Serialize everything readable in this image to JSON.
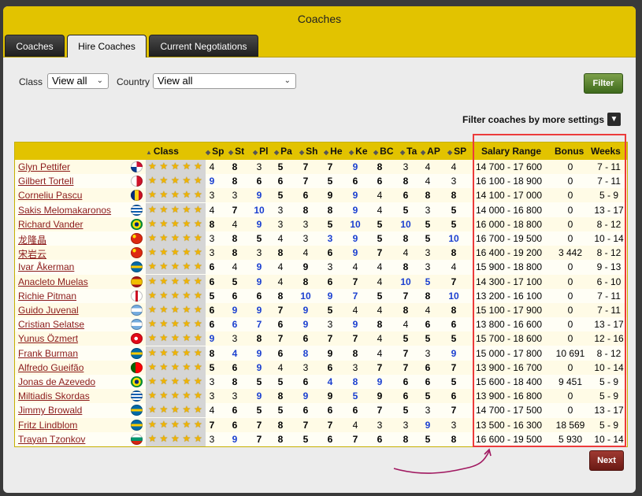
{
  "window": {
    "title": "Coaches"
  },
  "tabs": [
    {
      "label": "Coaches",
      "active": false
    },
    {
      "label": "Hire Coaches",
      "active": true
    },
    {
      "label": "Current Negotiations",
      "active": false
    }
  ],
  "filters": {
    "class_label": "Class",
    "class_value": "View all",
    "country_label": "Country",
    "country_value": "View all",
    "filter_button": "Filter",
    "more_settings": "Filter coaches by more settings"
  },
  "table": {
    "headers": {
      "class": "Class",
      "sp": "Sp",
      "st": "St",
      "pl": "Pl",
      "pa": "Pa",
      "sh": "Sh",
      "he": "He",
      "ke": "Ke",
      "bc": "BC",
      "ta": "Ta",
      "ap": "AP",
      "spt": "SP",
      "salary": "Salary Range",
      "bonus": "Bonus",
      "weeks": "Weeks"
    },
    "rows": [
      {
        "name": "Glyn Pettifer",
        "flag": "panama",
        "stars": 5,
        "sp": "4",
        "st": "8",
        "pl": "3",
        "pa": "5",
        "sh": "7",
        "he": "7",
        "ke": "9",
        "bc": "8",
        "ta": "3",
        "ap": "4",
        "spt": "4",
        "salary": "14 700 - 17 600",
        "bonus": "0",
        "weeks": "7 - 11"
      },
      {
        "name": "Gilbert Tortell",
        "flag": "malta",
        "stars": 5,
        "sp": "9",
        "st": "8",
        "pl": "6",
        "pa": "6",
        "sh": "7",
        "he": "5",
        "ke": "6",
        "bc": "6",
        "ta": "8",
        "ap": "4",
        "spt": "3",
        "salary": "16 100 - 18 900",
        "bonus": "0",
        "weeks": "7 - 11"
      },
      {
        "name": "Corneliu Pascu",
        "flag": "romania",
        "stars": 5,
        "sp": "3",
        "st": "3",
        "pl": "9",
        "pa": "5",
        "sh": "6",
        "he": "9",
        "ke": "9",
        "bc": "4",
        "ta": "6",
        "ap": "8",
        "spt": "8",
        "salary": "14 100 - 17 000",
        "bonus": "0",
        "weeks": "5 - 9"
      },
      {
        "name": "Sakis Melomakaronos",
        "flag": "greece",
        "stars": 5,
        "sp": "4",
        "st": "7",
        "pl": "10",
        "pa": "3",
        "sh": "8",
        "he": "8",
        "ke": "9",
        "bc": "4",
        "ta": "5",
        "ap": "3",
        "spt": "5",
        "salary": "14 000 - 16 800",
        "bonus": "0",
        "weeks": "13 - 17"
      },
      {
        "name": "Richard Vander",
        "flag": "brazil",
        "stars": 5,
        "sp": "8",
        "st": "4",
        "pl": "9",
        "pa": "3",
        "sh": "3",
        "he": "5",
        "ke": "10",
        "bc": "5",
        "ta": "10",
        "ap": "5",
        "spt": "5",
        "salary": "16 000 - 18 800",
        "bonus": "0",
        "weeks": "8 - 12"
      },
      {
        "name": "龙隆晶",
        "flag": "china",
        "stars": 5,
        "sp": "3",
        "st": "8",
        "pl": "5",
        "pa": "4",
        "sh": "3",
        "he": "3",
        "ke": "9",
        "bc": "5",
        "ta": "8",
        "ap": "5",
        "spt": "10",
        "salary": "16 700 - 19 500",
        "bonus": "0",
        "weeks": "10 - 14"
      },
      {
        "name": "宋岩云",
        "flag": "china",
        "stars": 5,
        "sp": "3",
        "st": "8",
        "pl": "3",
        "pa": "8",
        "sh": "4",
        "he": "6",
        "ke": "9",
        "bc": "7",
        "ta": "4",
        "ap": "3",
        "spt": "8",
        "salary": "16 400 - 19 200",
        "bonus": "3 442",
        "weeks": "8 - 12"
      },
      {
        "name": "Ivar Åkerman",
        "flag": "sweden",
        "stars": 5,
        "sp": "6",
        "st": "4",
        "pl": "9",
        "pa": "4",
        "sh": "9",
        "he": "3",
        "ke": "4",
        "bc": "4",
        "ta": "8",
        "ap": "3",
        "spt": "4",
        "salary": "15 900 - 18 800",
        "bonus": "0",
        "weeks": "9 - 13"
      },
      {
        "name": "Anacleto Muelas",
        "flag": "spain",
        "stars": 5,
        "sp": "6",
        "st": "5",
        "pl": "9",
        "pa": "4",
        "sh": "8",
        "he": "6",
        "ke": "7",
        "bc": "4",
        "ta": "10",
        "ap": "5",
        "spt": "7",
        "salary": "14 300 - 17 100",
        "bonus": "0",
        "weeks": "6 - 10"
      },
      {
        "name": "Richie Pitman",
        "flag": "england",
        "stars": 5,
        "sp": "5",
        "st": "6",
        "pl": "6",
        "pa": "8",
        "sh": "10",
        "he": "9",
        "ke": "7",
        "bc": "5",
        "ta": "7",
        "ap": "8",
        "spt": "10",
        "salary": "13 200 - 16 100",
        "bonus": "0",
        "weeks": "7 - 11"
      },
      {
        "name": "Guido Juvenal",
        "flag": "argentina",
        "stars": 5,
        "sp": "6",
        "st": "9",
        "pl": "9",
        "pa": "7",
        "sh": "9",
        "he": "5",
        "ke": "4",
        "bc": "4",
        "ta": "8",
        "ap": "4",
        "spt": "8",
        "salary": "15 100 - 17 900",
        "bonus": "0",
        "weeks": "7 - 11"
      },
      {
        "name": "Cristian Selatse",
        "flag": "argentina",
        "stars": 5,
        "sp": "6",
        "st": "6",
        "pl": "7",
        "pa": "6",
        "sh": "9",
        "he": "3",
        "ke": "9",
        "bc": "8",
        "ta": "4",
        "ap": "6",
        "spt": "6",
        "salary": "13 800 - 16 600",
        "bonus": "0",
        "weeks": "13 - 17"
      },
      {
        "name": "Yunus Özmert",
        "flag": "turkey",
        "stars": 5,
        "sp": "9",
        "st": "3",
        "pl": "8",
        "pa": "7",
        "sh": "6",
        "he": "7",
        "ke": "7",
        "bc": "4",
        "ta": "5",
        "ap": "5",
        "spt": "5",
        "salary": "15 700 - 18 600",
        "bonus": "0",
        "weeks": "12 - 16"
      },
      {
        "name": "Frank Burman",
        "flag": "sweden",
        "stars": 5,
        "sp": "8",
        "st": "4",
        "pl": "9",
        "pa": "6",
        "sh": "8",
        "he": "9",
        "ke": "8",
        "bc": "4",
        "ta": "7",
        "ap": "3",
        "spt": "9",
        "salary": "15 000 - 17 800",
        "bonus": "10 691",
        "weeks": "8 - 12"
      },
      {
        "name": "Alfredo Gueifão",
        "flag": "portugal",
        "stars": 5,
        "sp": "5",
        "st": "6",
        "pl": "9",
        "pa": "4",
        "sh": "3",
        "he": "6",
        "ke": "3",
        "bc": "7",
        "ta": "7",
        "ap": "6",
        "spt": "7",
        "salary": "13 900 - 16 700",
        "bonus": "0",
        "weeks": "10 - 14"
      },
      {
        "name": "Jonas de Azevedo",
        "flag": "brazil",
        "stars": 5,
        "sp": "3",
        "st": "8",
        "pl": "5",
        "pa": "5",
        "sh": "6",
        "he": "4",
        "ke": "8",
        "bc": "9",
        "ta": "6",
        "ap": "6",
        "spt": "5",
        "salary": "15 600 - 18 400",
        "bonus": "9 451",
        "weeks": "5 - 9"
      },
      {
        "name": "Miltiadis Skordas",
        "flag": "greece",
        "stars": 5,
        "sp": "3",
        "st": "3",
        "pl": "9",
        "pa": "8",
        "sh": "9",
        "he": "9",
        "ke": "5",
        "bc": "9",
        "ta": "6",
        "ap": "5",
        "spt": "6",
        "salary": "13 900 - 16 800",
        "bonus": "0",
        "weeks": "5 - 9"
      },
      {
        "name": "Jimmy Browald",
        "flag": "sweden",
        "stars": 5,
        "sp": "4",
        "st": "6",
        "pl": "5",
        "pa": "5",
        "sh": "6",
        "he": "6",
        "ke": "6",
        "bc": "7",
        "ta": "5",
        "ap": "3",
        "spt": "7",
        "salary": "14 700 - 17 500",
        "bonus": "0",
        "weeks": "13 - 17"
      },
      {
        "name": "Fritz Lindblom",
        "flag": "sweden",
        "stars": 5,
        "sp": "7",
        "st": "6",
        "pl": "7",
        "pa": "8",
        "sh": "7",
        "he": "7",
        "ke": "4",
        "bc": "3",
        "ta": "3",
        "ap": "9",
        "spt": "3",
        "salary": "13 500 - 16 300",
        "bonus": "18 569",
        "weeks": "5 - 9"
      },
      {
        "name": "Trayan Tzonkov",
        "flag": "bulgaria",
        "stars": 5,
        "sp": "3",
        "st": "9",
        "pl": "7",
        "pa": "8",
        "sh": "5",
        "he": "6",
        "ke": "7",
        "bc": "6",
        "ta": "8",
        "ap": "5",
        "spt": "8",
        "salary": "16 600 - 19 500",
        "bonus": "5 930",
        "weeks": "10 - 14"
      }
    ]
  },
  "next_button": "Next",
  "colors": {
    "header": "#e2c300",
    "name_link": "#8b1a1a",
    "blue_value": "#1a3fd0",
    "annotation": "#ec3b3b"
  }
}
